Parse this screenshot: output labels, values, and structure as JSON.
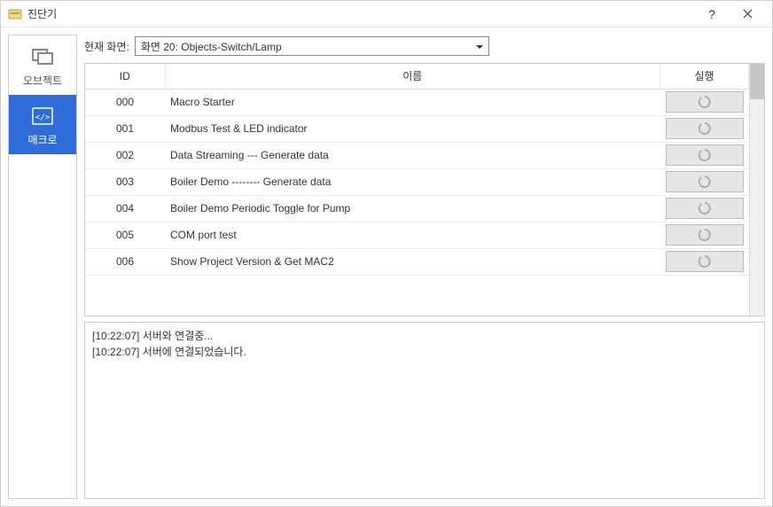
{
  "window": {
    "title": "진단기"
  },
  "sidebar": {
    "items": [
      {
        "label": "오브젝트"
      },
      {
        "label": "매크로"
      }
    ]
  },
  "toolbar": {
    "screen_label": "현재 화면:",
    "screen_value": "화면 20: Objects-Switch/Lamp"
  },
  "table": {
    "headers": {
      "id": "ID",
      "name": "이름",
      "run": "실행"
    },
    "rows": [
      {
        "id": "000",
        "name": "Macro Starter"
      },
      {
        "id": "001",
        "name": "Modbus Test & LED indicator"
      },
      {
        "id": "002",
        "name": "Data Streaming --- Generate data"
      },
      {
        "id": "003",
        "name": "Boiler Demo -------- Generate data"
      },
      {
        "id": "004",
        "name": "Boiler Demo Periodic Toggle for Pump"
      },
      {
        "id": "005",
        "name": "COM port test"
      },
      {
        "id": "006",
        "name": "Show Project Version & Get MAC2"
      }
    ]
  },
  "log": {
    "lines": [
      "[10:22:07] 서버와 연결중...",
      "[10:22:07] 서버에 연결되었습니다."
    ]
  }
}
